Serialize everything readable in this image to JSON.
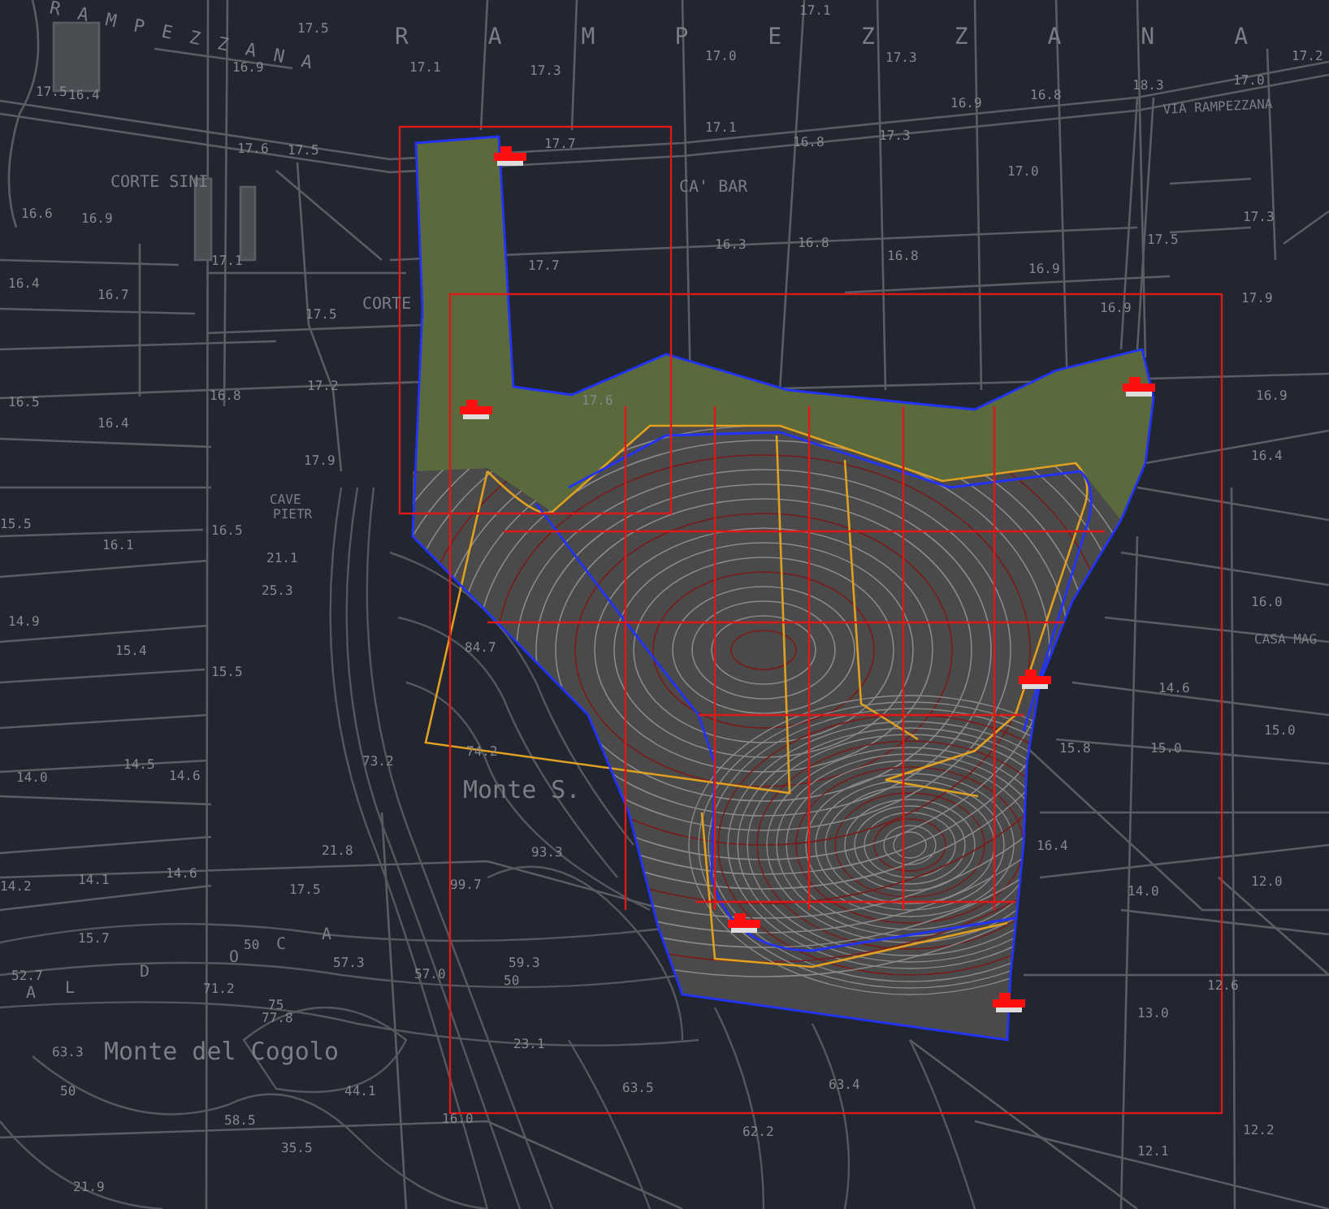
{
  "map": {
    "place_names": [
      "R A M P E Z Z A N A",
      "R A M P E Z Z A N A",
      "CORTE SINI",
      "CORTE",
      "CA' BAR",
      "VIA RAMPEZZANA",
      "CAVE",
      "PIETR",
      "CASA MAG",
      "Monte S.",
      "Monte del Cogolo",
      "A",
      "L",
      "D",
      "O",
      "C",
      "A"
    ],
    "elevations": [
      "17.5",
      "16.9",
      "17.5",
      "16.4",
      "17.6",
      "17.5",
      "16.6",
      "16.9",
      "17.1",
      "16.4",
      "16.7",
      "17.5",
      "17.2",
      "16.8",
      "16.5",
      "17.1",
      "17.3",
      "17.7",
      "17.7",
      "17.6",
      "17.1",
      "17.0",
      "17.3",
      "16.8",
      "16.9",
      "18.3",
      "17.0",
      "17.2",
      "17.1",
      "16.8",
      "17.3",
      "17.0",
      "17.3",
      "17.5",
      "16.3",
      "16.8",
      "16.8",
      "16.9",
      "16.9",
      "17.9",
      "16.9",
      "16.4",
      "17.9",
      "15.5",
      "16.5",
      "16.1",
      "21.1",
      "25.3",
      "14.9",
      "15.4",
      "15.5",
      "84.7",
      "74.2",
      "73.2",
      "14.5",
      "14.6",
      "14.0",
      "16.4",
      "16.0",
      "14.6",
      "15.8",
      "15.0",
      "15.0",
      "14.2",
      "14.1",
      "14.6",
      "21.8",
      "17.5",
      "15.7",
      "50",
      "57.3",
      "57.0",
      "52.7",
      "71.2",
      "75",
      "77.8",
      "63.3",
      "50",
      "58.5",
      "35.5",
      "44.1",
      "16.0",
      "21.9",
      "99.7",
      "93.3",
      "59.3",
      "50",
      "23.1",
      "63.5",
      "16.4",
      "14.0",
      "12.0",
      "12.6",
      "13.0",
      "12.2",
      "12.1",
      "63.4",
      "62.2"
    ]
  }
}
